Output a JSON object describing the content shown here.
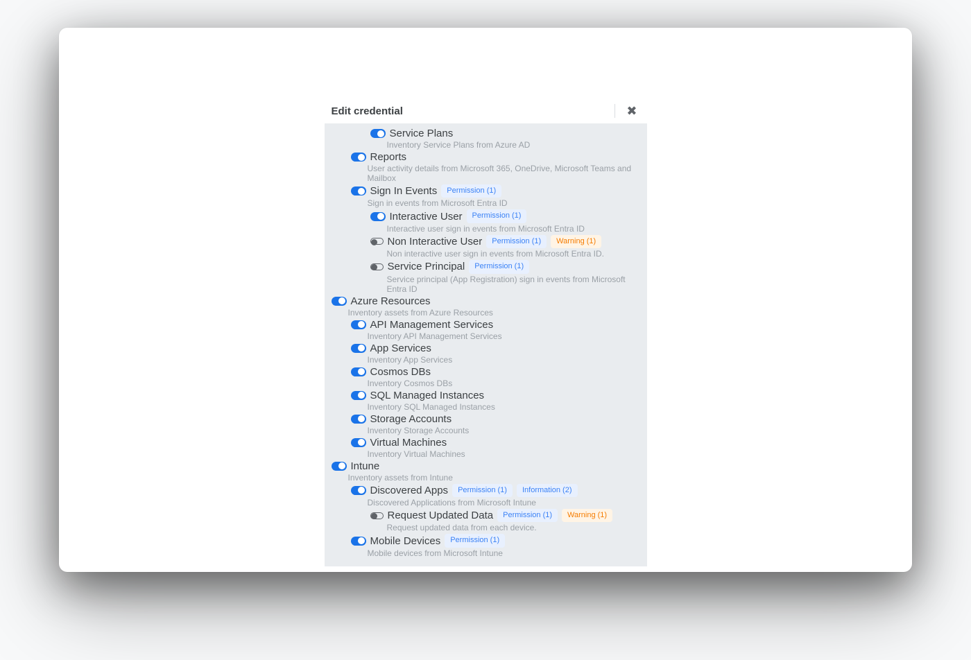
{
  "modal": {
    "title": "Edit credential"
  },
  "rows": [
    {
      "indent": 2,
      "toggle": "on",
      "label": "Service Plans",
      "desc": "Inventory Service Plans from Azure AD"
    },
    {
      "indent": 1,
      "toggle": "on",
      "label": "Reports",
      "desc": "User activity details from Microsoft 365, OneDrive, Microsoft Teams and Mailbox"
    },
    {
      "indent": 1,
      "toggle": "on",
      "label": "Sign In Events",
      "desc": "Sign in events from Microsoft Entra ID",
      "badges": [
        {
          "type": "permission",
          "text": "Permission (1)"
        }
      ]
    },
    {
      "indent": 2,
      "toggle": "on",
      "label": "Interactive User",
      "desc": "Interactive user sign in events from Microsoft Entra ID",
      "badges": [
        {
          "type": "permission",
          "text": "Permission (1)"
        }
      ]
    },
    {
      "indent": 2,
      "toggle": "off",
      "label": "Non Interactive User",
      "desc": "Non interactive user sign in events from Microsoft Entra ID.",
      "badges": [
        {
          "type": "permission",
          "text": "Permission (1)"
        },
        {
          "type": "warning",
          "text": "Warning (1)"
        }
      ]
    },
    {
      "indent": 2,
      "toggle": "off",
      "label": "Service Principal",
      "desc": "Service principal (App Registration) sign in events from Microsoft Entra ID",
      "badges": [
        {
          "type": "permission",
          "text": "Permission (1)"
        }
      ]
    },
    {
      "indent": 0,
      "toggle": "on",
      "label": "Azure Resources",
      "desc": "Inventory assets from Azure Resources"
    },
    {
      "indent": 1,
      "toggle": "on",
      "label": "API Management Services",
      "desc": "Inventory API Management Services"
    },
    {
      "indent": 1,
      "toggle": "on",
      "label": "App Services",
      "desc": "Inventory App Services"
    },
    {
      "indent": 1,
      "toggle": "on",
      "label": "Cosmos DBs",
      "desc": "Inventory Cosmos DBs"
    },
    {
      "indent": 1,
      "toggle": "on",
      "label": "SQL Managed Instances",
      "desc": "Inventory SQL Managed Instances"
    },
    {
      "indent": 1,
      "toggle": "on",
      "label": "Storage Accounts",
      "desc": "Inventory Storage Accounts"
    },
    {
      "indent": 1,
      "toggle": "on",
      "label": "Virtual Machines",
      "desc": "Inventory Virtual Machines"
    },
    {
      "indent": 0,
      "toggle": "on",
      "label": "Intune",
      "desc": "Inventory assets from Intune"
    },
    {
      "indent": 1,
      "toggle": "on",
      "label": "Discovered Apps",
      "desc": "Discovered Applications from Microsoft Intune",
      "badges": [
        {
          "type": "permission",
          "text": "Permission (1)"
        },
        {
          "type": "information",
          "text": "Information (2)"
        }
      ]
    },
    {
      "indent": 2,
      "toggle": "off",
      "label": "Request Updated Data",
      "desc": "Request updated data from each device.",
      "badges": [
        {
          "type": "permission",
          "text": "Permission (1)"
        },
        {
          "type": "warning",
          "text": "Warning (1)"
        }
      ]
    },
    {
      "indent": 1,
      "toggle": "on",
      "label": "Mobile Devices",
      "desc": "Mobile devices from Microsoft Intune",
      "badges": [
        {
          "type": "permission",
          "text": "Permission (1)"
        }
      ]
    }
  ]
}
